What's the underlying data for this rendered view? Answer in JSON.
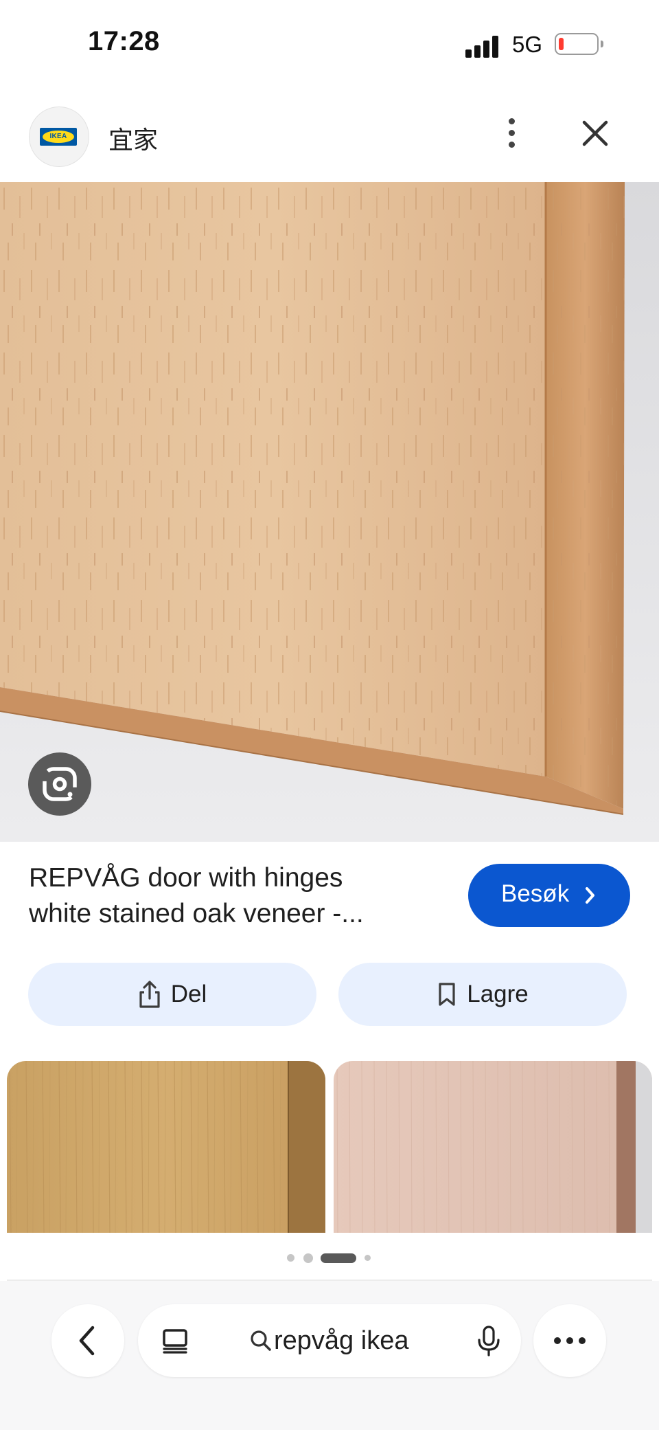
{
  "status_bar": {
    "time": "17:28",
    "network": "5G"
  },
  "header": {
    "site_name": "宜家",
    "logo_text": "IKEA"
  },
  "result": {
    "title_line1": "REPVÅG door with hinges",
    "title_line2": "white stained oak veneer -...",
    "visit_label": "Besøk"
  },
  "actions": {
    "share_label": "Del",
    "save_label": "Lagre"
  },
  "pager": {
    "count": 4,
    "active_index": 2
  },
  "search": {
    "query": "repvåg ikea"
  },
  "colors": {
    "accent": "#0b57d0",
    "pill_bg": "#e8f0fe"
  },
  "icons": [
    "ikea-logo",
    "more-vert-icon",
    "close-icon",
    "google-lens-icon",
    "chevron-right-icon",
    "share-icon",
    "bookmark-icon",
    "chevron-left-icon",
    "tabs-icon",
    "search-icon",
    "mic-icon",
    "more-horiz-icon"
  ]
}
